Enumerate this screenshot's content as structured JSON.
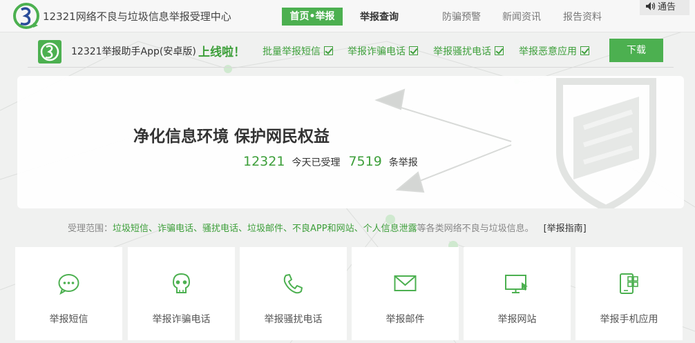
{
  "header": {
    "site_title": "12321网络不良与垃圾信息举报受理中心",
    "nav": {
      "home": "首页•举报",
      "query": "举报查询",
      "fraud": "防骗预警",
      "news": "新闻资讯",
      "reports": "报告资料"
    },
    "notice": "通告"
  },
  "appbar": {
    "app_name": "12321举报助手App(安卓版)",
    "online": "上线啦！",
    "features": [
      "批量举报短信",
      "举报诈骗电话",
      "举报骚扰电话",
      "举报恶意应用"
    ],
    "download": "下载"
  },
  "hero": {
    "slogan": "净化信息环境 保护网民权益",
    "hotline": "12321",
    "today_label": "今天已受理",
    "count": "7519",
    "unit_label": "条举报"
  },
  "scope": {
    "prefix": "受理范围：",
    "items": "垃圾短信、诈骗电话、骚扰电话、垃圾邮件、不良APP和网站、个人信息泄露",
    "suffix": "等各类网络不良与垃圾信息。",
    "guide": "[举报指南]"
  },
  "cards": [
    {
      "label": "举报短信",
      "icon": "sms-bubble-icon"
    },
    {
      "label": "举报诈骗电话",
      "icon": "skull-icon"
    },
    {
      "label": "举报骚扰电话",
      "icon": "phone-icon"
    },
    {
      "label": "举报邮件",
      "icon": "envelope-icon"
    },
    {
      "label": "举报网站",
      "icon": "monitor-icon"
    },
    {
      "label": "举报手机应用",
      "icon": "mobile-app-icon"
    }
  ],
  "colors": {
    "accent": "#4cb050",
    "accent_text": "#3d9f3a",
    "background": "#f0f1f0"
  }
}
